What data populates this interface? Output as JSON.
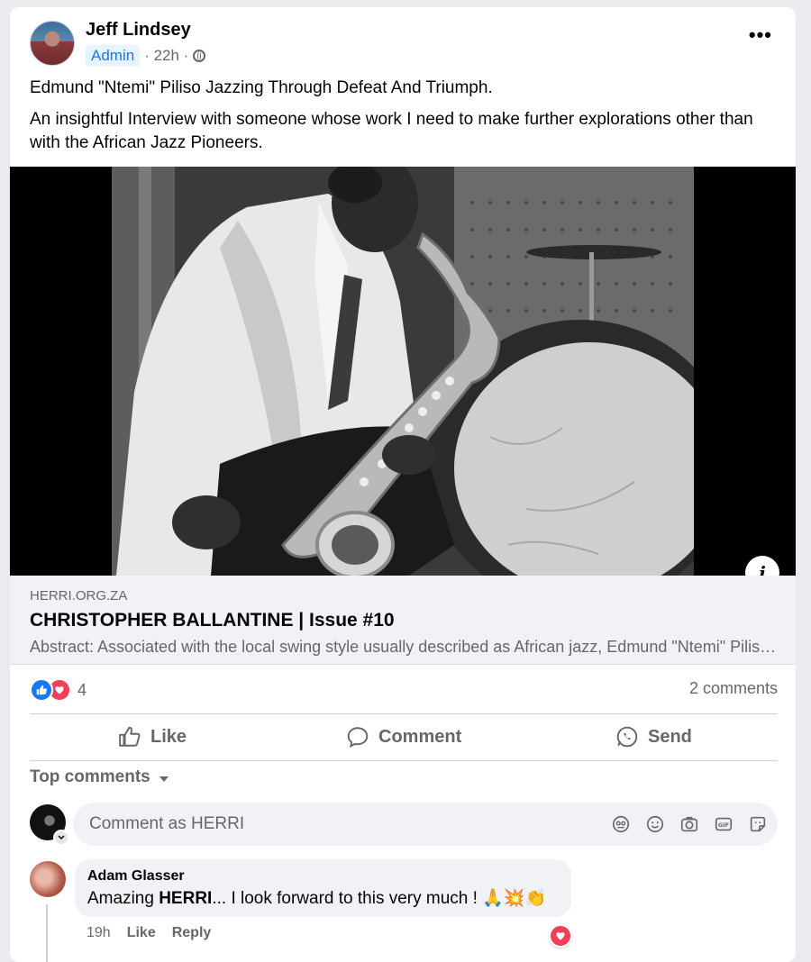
{
  "post": {
    "author": "Jeff Lindsey",
    "role_badge": "Admin",
    "time": "· 22h ·",
    "text_line1": "Edmund \"Ntemi\" Piliso Jazzing Through Defeat And Triumph.",
    "text_line2": "An insightful Interview with someone whose work  I need to make further explorations other than with the African Jazz Pioneers.",
    "more_icon": "more-horizontal-icon",
    "visibility_icon": "globe-icon"
  },
  "link_preview": {
    "domain": "HERRI.ORG.ZA",
    "title": "CHRISTOPHER BALLANTINE | Issue #10",
    "abstract": "Abstract: Associated with the local swing style usually described as African jazz, Edmund \"Ntemi\" Piliso...",
    "info_icon": "info-icon"
  },
  "reactions": {
    "count": "4",
    "types": [
      "like-reaction-icon",
      "love-reaction-icon"
    ],
    "comments_count": "2 comments"
  },
  "actions": {
    "like": "Like",
    "comment": "Comment",
    "send": "Send"
  },
  "comments_section": {
    "sort_label": "Top comments",
    "input_placeholder": "Comment as HERRI",
    "input_icons": [
      "avatar-sticker-icon",
      "emoji-icon",
      "camera-icon",
      "gif-icon",
      "sticker-icon"
    ]
  },
  "comments": [
    {
      "author": "Adam Glasser",
      "text_prefix": "Amazing ",
      "text_bold": "HERRI",
      "text_suffix": "... I look forward to this very much ! 🙏💥👏",
      "time": "19h",
      "like_label": "Like",
      "reply_label": "Reply"
    }
  ],
  "colors": {
    "accent": "#1877f2",
    "love": "#f33e58",
    "muted": "#65676b",
    "bubble": "#f0f2f5"
  }
}
